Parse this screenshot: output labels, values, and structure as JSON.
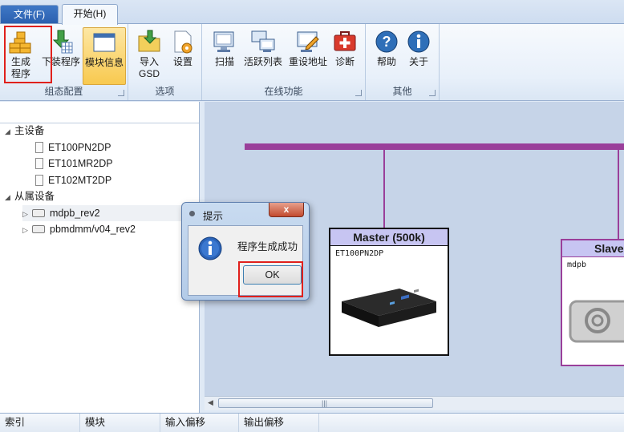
{
  "tabs": {
    "file": "文件(F)",
    "start": "开始(H)"
  },
  "ribbon": {
    "groups": {
      "config": "组态配置",
      "options": "选项",
      "online": "在线功能",
      "other": "其他"
    },
    "buttons": {
      "generate_line1": "生成",
      "generate_line2": "程序",
      "download": "下装程序",
      "module_info": "模块信息",
      "import_line1": "导入",
      "import_line2": "GSD",
      "settings": "设置",
      "scan": "扫描",
      "active_list": "活跃列表",
      "reset_address": "重设地址",
      "diagnose": "诊断",
      "help": "帮助",
      "about": "关于"
    }
  },
  "tree": {
    "master_root": "主设备",
    "masters": [
      "ET100PN2DP",
      "ET101MR2DP",
      "ET102MT2DP"
    ],
    "slave_root": "从属设备",
    "slaves": [
      "mdpb_rev2",
      "pbmdmm/v04_rev2"
    ]
  },
  "canvas": {
    "master": {
      "title": "Master (500k)",
      "device": "ET100PN2DP"
    },
    "slave": {
      "title": "Slave",
      "device": "mdpb"
    }
  },
  "bottom_columns": [
    "索引",
    "模块",
    "输入偏移",
    "输出偏移"
  ],
  "dialog": {
    "title": "提示",
    "message": "程序生成成功",
    "ok": "OK",
    "close": "x"
  },
  "colors": {
    "bus": "#9a3f9a",
    "highlight": "#e0201c",
    "node_title_bg": "#c7c5f2"
  }
}
